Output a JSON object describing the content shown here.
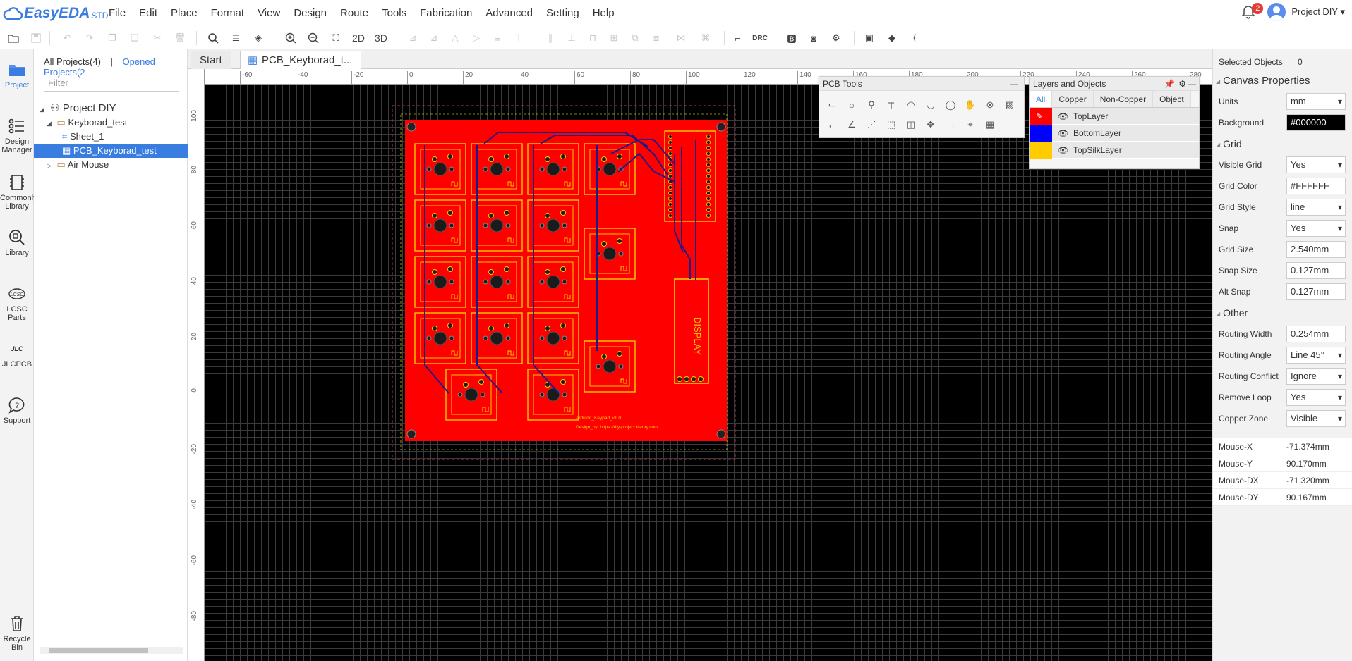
{
  "app": {
    "logo": "EasyEDA",
    "edition": "STD"
  },
  "menu": [
    "File",
    "Edit",
    "Place",
    "Format",
    "View",
    "Design",
    "Route",
    "Tools",
    "Fabrication",
    "Advanced",
    "Setting",
    "Help"
  ],
  "user": {
    "notifications": "2",
    "project_menu": "Project DIY ▾"
  },
  "toolbar": {
    "btn_2d": "2D",
    "btn_3d": "3D",
    "btn_drc": "DRC"
  },
  "rail": [
    {
      "label": "Project",
      "icon": "folder-project-icon"
    },
    {
      "label": "Design Manager",
      "icon": "design-manager-icon"
    },
    {
      "label": "Commonly Library",
      "icon": "common-library-icon"
    },
    {
      "label": "Library",
      "icon": "library-search-icon"
    },
    {
      "label": "LCSC Parts",
      "icon": "lcsc-icon"
    },
    {
      "label": "JLCPCB",
      "icon": "jlcpcb-icon"
    },
    {
      "label": "Support",
      "icon": "support-icon"
    },
    {
      "label": "Recycle Bin",
      "icon": "trash-icon"
    }
  ],
  "project_panel": {
    "tab_all": "All Projects(4)",
    "tab_sep": "|",
    "tab_opened": "Opened Projects(2",
    "filter_placeholder": "Filter",
    "tree": [
      {
        "label": "Project DIY",
        "level": 0
      },
      {
        "label": "Keyborad_test",
        "level": 1
      },
      {
        "label": "Sheet_1",
        "level": 2
      },
      {
        "label": "PCB_Keyborad_test",
        "level": 2,
        "selected": true
      },
      {
        "label": "Air Mouse",
        "level": 1
      }
    ]
  },
  "doc_tabs": [
    {
      "label": "Start"
    },
    {
      "label": "PCB_Keyborad_t...",
      "active": true
    }
  ],
  "ruler": {
    "top": [
      "-60",
      "-40",
      "-20",
      "0",
      "20",
      "40",
      "60",
      "80",
      "100",
      "120",
      "140",
      "160",
      "180",
      "200",
      "220",
      "240",
      "260",
      "280"
    ],
    "left": [
      "100",
      "80",
      "60",
      "40",
      "20",
      "0",
      "-20",
      "-40",
      "-60",
      "-80"
    ]
  },
  "pcb": {
    "label_display": "DISPLAY",
    "label_version": "Arduino_Keypad_v1.0",
    "label_design": "Design_by: https://diy-project.tistory.com"
  },
  "pcb_tools": {
    "title": "PCB Tools"
  },
  "layers": {
    "title": "Layers and Objects",
    "tabs": [
      "All",
      "Copper",
      "Non-Copper",
      "Object"
    ],
    "rows": [
      {
        "name": "TopLayer",
        "color": "#ff0000"
      },
      {
        "name": "BottomLayer",
        "color": "#0000ff"
      },
      {
        "name": "TopSilkLayer",
        "color": "#ffcc00"
      }
    ]
  },
  "right": {
    "selected_label": "Selected Objects",
    "selected_count": "0",
    "canvas_props": "Canvas Properties",
    "units_label": "Units",
    "units": "mm",
    "bg_label": "Background",
    "bg": "#000000",
    "grid_head": "Grid",
    "visible_grid_label": "Visible Grid",
    "visible_grid": "Yes",
    "grid_color_label": "Grid Color",
    "grid_color": "#FFFFFF",
    "grid_style_label": "Grid Style",
    "grid_style": "line",
    "snap_label": "Snap",
    "snap": "Yes",
    "grid_size_label": "Grid Size",
    "grid_size": "2.540mm",
    "snap_size_label": "Snap Size",
    "snap_size": "0.127mm",
    "alt_snap_label": "Alt Snap",
    "alt_snap": "0.127mm",
    "other_head": "Other",
    "routing_width_label": "Routing Width",
    "routing_width": "0.254mm",
    "routing_angle_label": "Routing Angle",
    "routing_angle": "Line 45°",
    "routing_conflict_label": "Routing Conflict",
    "routing_conflict": "Ignore",
    "remove_loop_label": "Remove Loop",
    "remove_loop": "Yes",
    "copper_zone_label": "Copper Zone",
    "copper_zone": "Visible",
    "mouse": [
      {
        "k": "Mouse-X",
        "v": "-71.374mm"
      },
      {
        "k": "Mouse-Y",
        "v": "90.170mm"
      },
      {
        "k": "Mouse-DX",
        "v": "-71.320mm"
      },
      {
        "k": "Mouse-DY",
        "v": "90.167mm"
      }
    ]
  }
}
